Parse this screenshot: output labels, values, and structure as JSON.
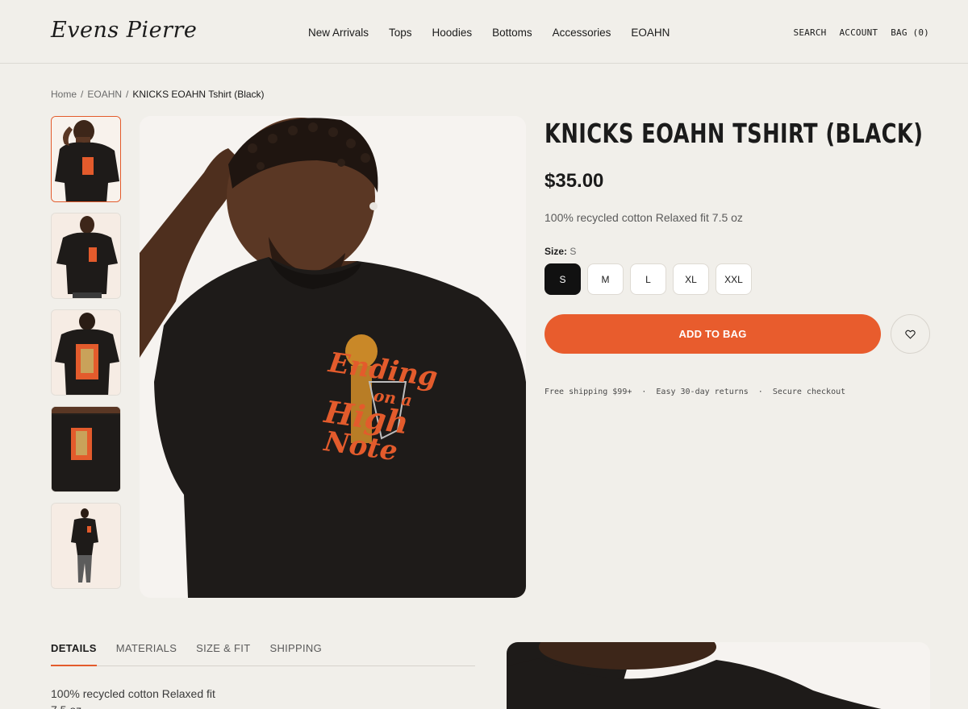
{
  "header": {
    "logo": "Evens Pierre",
    "nav": [
      "New Arrivals",
      "Tops",
      "Hoodies",
      "Bottoms",
      "Accessories",
      "EOAHN"
    ],
    "search": "SEARCH",
    "account": "ACCOUNT",
    "bag": "BAG (0)"
  },
  "breadcrumb": {
    "home": "Home",
    "sep1": "/",
    "collection": "EOAHN",
    "sep2": "/",
    "current": "KNICKS EOAHN Tshirt (Black)"
  },
  "product": {
    "title": "KNICKS EOAHN TSHIRT (BLACK)",
    "price": "$35.00",
    "description": "100% recycled cotton Relaxed fit 7.5 oz",
    "size_label": "Size:",
    "size_value": "S",
    "sizes": [
      "S",
      "M",
      "L",
      "XL",
      "XXL"
    ],
    "selected_size": "S",
    "add_to_bag": "ADD TO BAG",
    "perks": [
      "Free shipping $99+",
      "·",
      "Easy 30-day returns",
      "·",
      "Secure checkout"
    ],
    "graphic_text": [
      "Ending",
      "on a",
      "High",
      "Note"
    ]
  },
  "tabs": {
    "items": [
      "DETAILS",
      "MATERIALS",
      "SIZE & FIT",
      "SHIPPING"
    ],
    "active": "DETAILS"
  },
  "details": {
    "line1": "100% recycled cotton Relaxed fit",
    "line2": "7.5 oz"
  },
  "colors": {
    "accent": "#e85c2d",
    "background": "#f1efea",
    "shirt": "#1e1b19",
    "skin": "#5a3724"
  }
}
